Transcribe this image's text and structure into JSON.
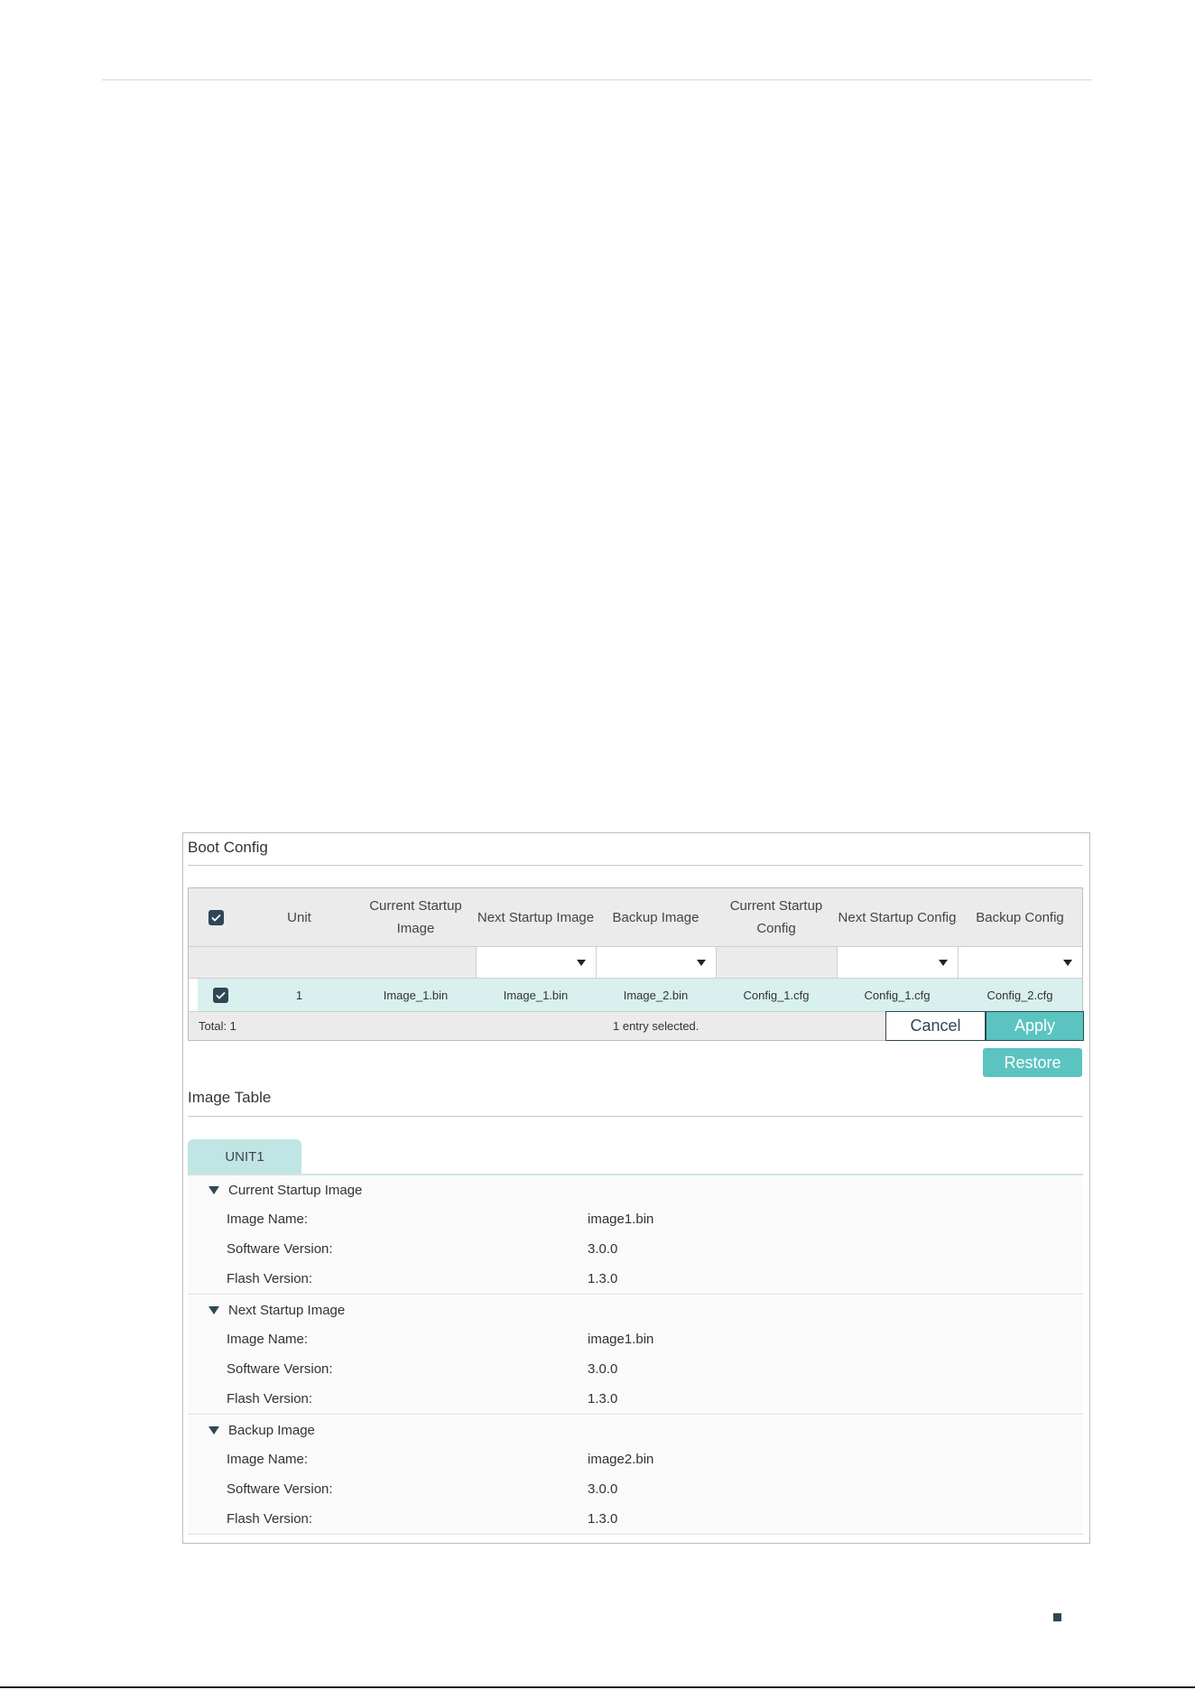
{
  "boot_config": {
    "title": "Boot Config",
    "columns": [
      "Unit",
      "Current Startup Image",
      "Next Startup Image",
      "Backup Image",
      "Current Startup Config",
      "Next Startup Config",
      "Backup Config"
    ],
    "rows": [
      {
        "unit": "1",
        "current_startup_image": "Image_1.bin",
        "next_startup_image": "Image_1.bin",
        "backup_image": "Image_2.bin",
        "current_startup_config": "Config_1.cfg",
        "next_startup_config": "Config_1.cfg",
        "backup_config": "Config_2.cfg"
      }
    ],
    "footer": {
      "total": "Total: 1",
      "selected": "1 entry selected.",
      "cancel": "Cancel",
      "apply": "Apply"
    },
    "restore": "Restore"
  },
  "image_table": {
    "title": "Image Table",
    "tab": "UNIT1",
    "sections": [
      {
        "title": "Current Startup Image",
        "fields": [
          {
            "label": "Image Name:",
            "value": "image1.bin"
          },
          {
            "label": "Software Version:",
            "value": "3.0.0"
          },
          {
            "label": "Flash Version:",
            "value": "1.3.0"
          }
        ]
      },
      {
        "title": "Next Startup Image",
        "fields": [
          {
            "label": "Image Name:",
            "value": "image1.bin"
          },
          {
            "label": "Software Version:",
            "value": "3.0.0"
          },
          {
            "label": "Flash Version:",
            "value": "1.3.0"
          }
        ]
      },
      {
        "title": "Backup Image",
        "fields": [
          {
            "label": "Image Name:",
            "value": "image2.bin"
          },
          {
            "label": "Software Version:",
            "value": "3.0.0"
          },
          {
            "label": "Flash Version:",
            "value": "1.3.0"
          }
        ]
      }
    ]
  },
  "colors": {
    "accent": "#5bc4c0",
    "dark": "#2e4756",
    "selected_row": "#d8f0ee",
    "header_bg": "#ebebeb"
  }
}
